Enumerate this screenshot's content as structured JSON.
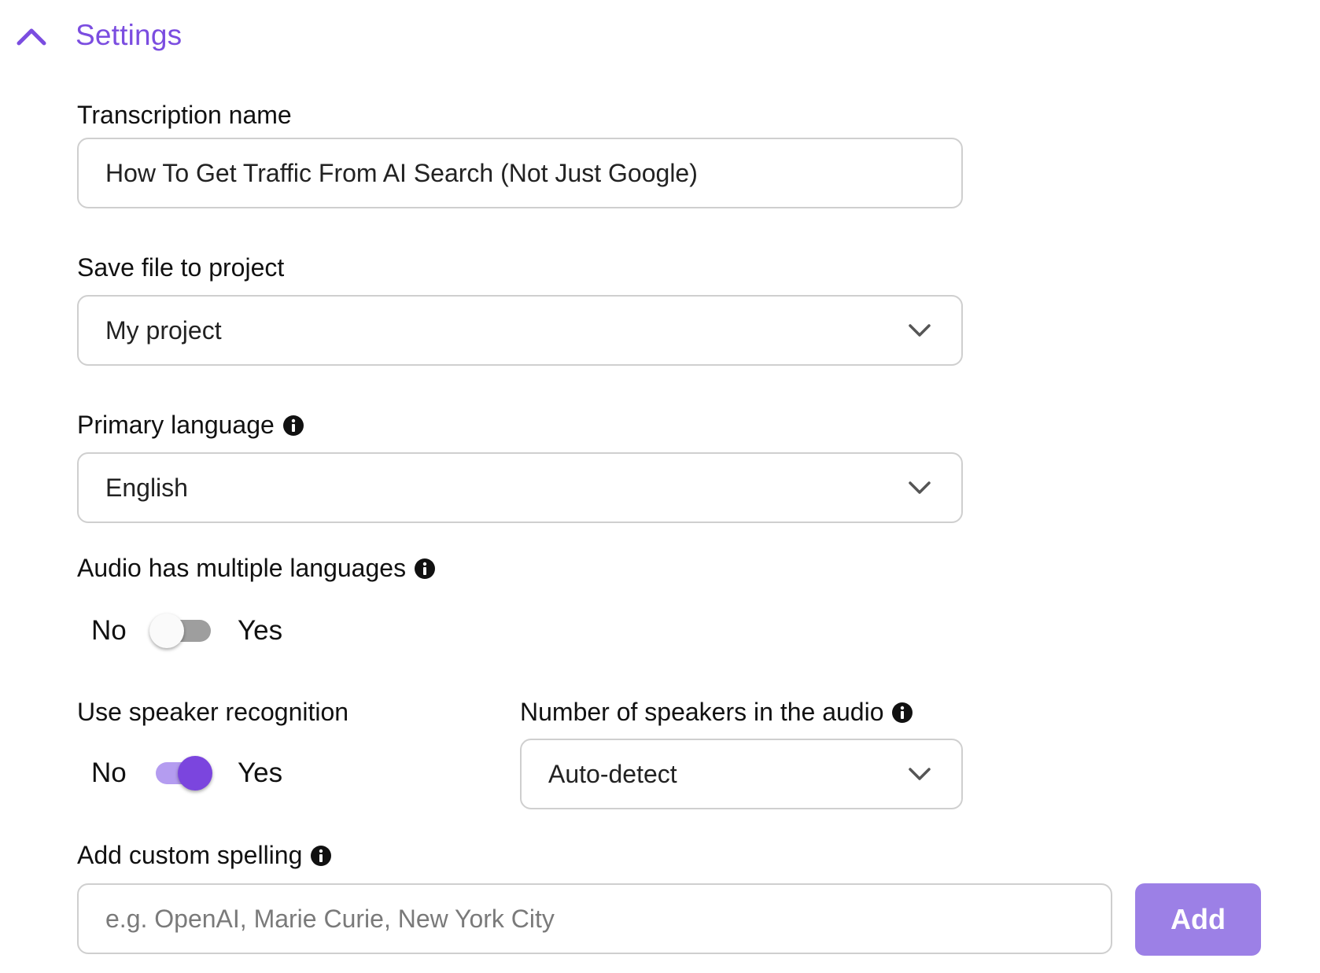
{
  "section": {
    "title": "Settings",
    "expanded_icon": "chevron-up-icon"
  },
  "transcription_name": {
    "label": "Transcription name",
    "value": "How To Get Traffic From AI Search (Not Just Google)"
  },
  "project": {
    "label": "Save file to project",
    "selected": "My project"
  },
  "primary_language": {
    "label": "Primary language",
    "selected": "English"
  },
  "multiple_languages": {
    "label": "Audio has multiple languages",
    "off_label": "No",
    "on_label": "Yes",
    "enabled": false
  },
  "speaker_recognition": {
    "label": "Use speaker recognition",
    "off_label": "No",
    "on_label": "Yes",
    "enabled": true
  },
  "speakers_count": {
    "label": "Number of speakers in the audio",
    "selected": "Auto-detect"
  },
  "custom_spelling": {
    "label": "Add custom spelling",
    "placeholder": "e.g. OpenAI, Marie Curie, New York City",
    "add_label": "Add"
  },
  "colors": {
    "accent": "#7b4de0",
    "toggle_on_knob": "#7b45de",
    "toggle_on_track": "#b49cf0",
    "toggle_off_track": "#9e9e9e",
    "add_button": "#9c80e6",
    "border": "#cfcfcf"
  }
}
